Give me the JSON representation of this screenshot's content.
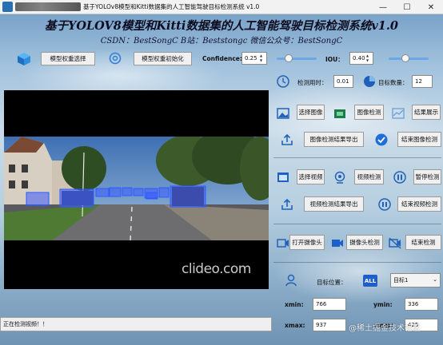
{
  "window": {
    "title": "基于YOLOv8模型和Kitti数据集的人工智能驾驶目标检测系统 v1.0",
    "controls": [
      "—",
      "☐",
      "✕"
    ]
  },
  "header": {
    "title": "基于YOLOV8模型和Kitti数据集的人工智能驾驶目标检测系统v1.0",
    "subtitle": "CSDN：BestSongC   B站：Beststongc   微信公众号：BestSongC"
  },
  "toolbar": {
    "select_weights_label": "模型权重选择",
    "init_weights_label": "模型权重初始化",
    "confidence_label": "Confidence:",
    "confidence_value": "0.25",
    "confidence_level": 0.25,
    "iou_label": "IOU：",
    "iou_value": "0.40",
    "iou_level": 0.4
  },
  "stats": {
    "time_label": "检测用时：",
    "time_value": "0.01",
    "count_label": "目标数量：",
    "count_value": "12"
  },
  "image_section": {
    "select_image": "选择图像",
    "detect_image": "图像检测",
    "show_result": "结果展示",
    "export_image": "图像检测结果导出",
    "finish_image": "结束图像检测"
  },
  "video_section": {
    "select_video": "选择视频",
    "detect_video": "视频检测",
    "pause_detect": "暂停检测",
    "export_video": "视频检测结果导出",
    "finish_video": "结束视频检测"
  },
  "camera_section": {
    "open_camera": "打开摄像头",
    "camera_detect": "摄像头检测",
    "finish_detect": "结束检测"
  },
  "target": {
    "position_label": "目标位置：",
    "all_badge": "ALL",
    "selected": "目标1",
    "xmin_label": "xmin:",
    "xmin_value": "766",
    "ymin_label": "ymin:",
    "ymin_value": "336",
    "xmax_label": "xmax:",
    "xmax_value": "937",
    "ymax_label": "ymax:",
    "ymax_value": "425"
  },
  "video": {
    "watermark": "clideo.com"
  },
  "status": {
    "text": "正在检测视频！！"
  },
  "site_watermark": "@稀土掘金技术社区",
  "colors": {
    "accent": "#1e5ec8",
    "detection_box": "#2a5cff",
    "slider_track": "#6aa8e8"
  }
}
